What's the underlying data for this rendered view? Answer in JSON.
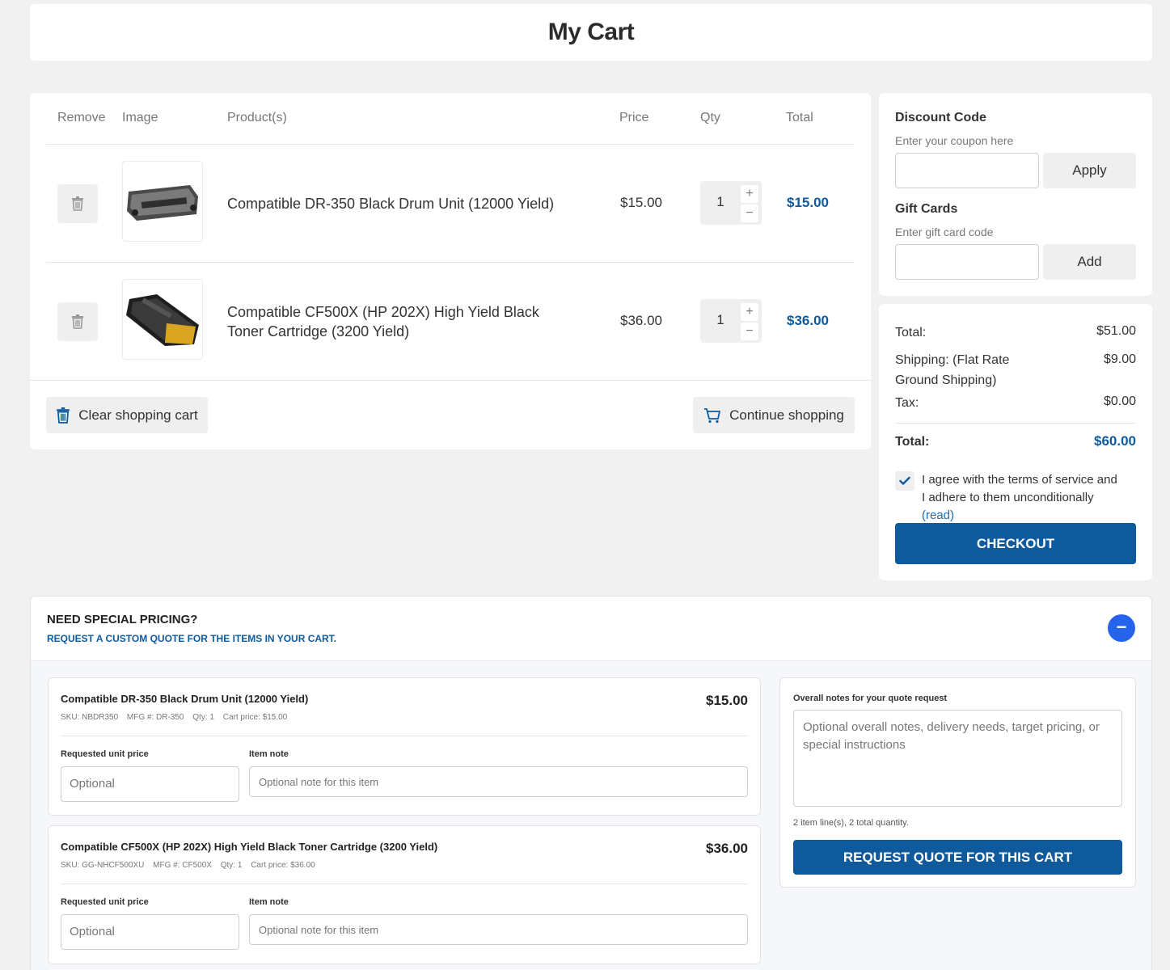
{
  "page": {
    "title": "My Cart"
  },
  "cart": {
    "headers": {
      "remove": "Remove",
      "image": "Image",
      "product": "Product(s)",
      "price": "Price",
      "qty": "Qty",
      "total": "Total"
    },
    "items": [
      {
        "name": "Compatible DR-350 Black Drum Unit (12000 Yield)",
        "price": "$15.00",
        "qty": "1",
        "total": "$15.00"
      },
      {
        "name": "Compatible CF500X (HP 202X) High Yield Black Toner Cartridge (3200 Yield)",
        "price": "$36.00",
        "qty": "1",
        "total": "$36.00"
      }
    ],
    "clear_label": "Clear shopping cart",
    "continue_label": "Continue shopping"
  },
  "discount": {
    "title": "Discount Code",
    "hint": "Enter your coupon here",
    "apply_label": "Apply",
    "gift_title": "Gift Cards",
    "gift_hint": "Enter gift card code",
    "add_label": "Add"
  },
  "summary": {
    "subtotal_label": "Total:",
    "subtotal": "$51.00",
    "shipping_label": "Shipping: (Flat Rate Ground Shipping)",
    "shipping": "$9.00",
    "tax_label": "Tax:",
    "tax": "$0.00",
    "total_label": "Total:",
    "total": "$60.00",
    "agree_text": "I agree with the terms of service and I adhere to them unconditionally",
    "read_label": "(read)",
    "checkout_label": "CHECKOUT"
  },
  "special": {
    "title": "NEED SPECIAL PRICING?",
    "subtitle": "REQUEST A CUSTOM QUOTE FOR THE ITEMS IN YOUR CART.",
    "toggle": "−",
    "unit_price_label": "Requested unit price",
    "unit_price_placeholder": "Optional",
    "note_label": "Item note",
    "note_placeholder": "Optional note for this item",
    "items": [
      {
        "name": "Compatible DR-350 Black Drum Unit (12000 Yield)",
        "price": "$15.00",
        "sku": "SKU: NBDR350",
        "mfg": "MFG #: DR-350",
        "qty": "Qty: 1",
        "cart_price": "Cart price: $15.00"
      },
      {
        "name": "Compatible CF500X (HP 202X) High Yield Black Toner Cartridge (3200 Yield)",
        "price": "$36.00",
        "sku": "SKU: GG-NHCF500XU",
        "mfg": "MFG #: CF500X",
        "qty": "Qty: 1",
        "cart_price": "Cart price: $36.00"
      }
    ],
    "notes_label": "Overall notes for your quote request",
    "notes_placeholder": "Optional overall notes, delivery needs, target pricing, or special instructions",
    "count_text": "2 item line(s), 2 total quantity.",
    "request_label": "REQUEST QUOTE FOR THIS CART"
  },
  "colors": {
    "accent": "#0e5a9c",
    "toggle": "#2563eb"
  }
}
